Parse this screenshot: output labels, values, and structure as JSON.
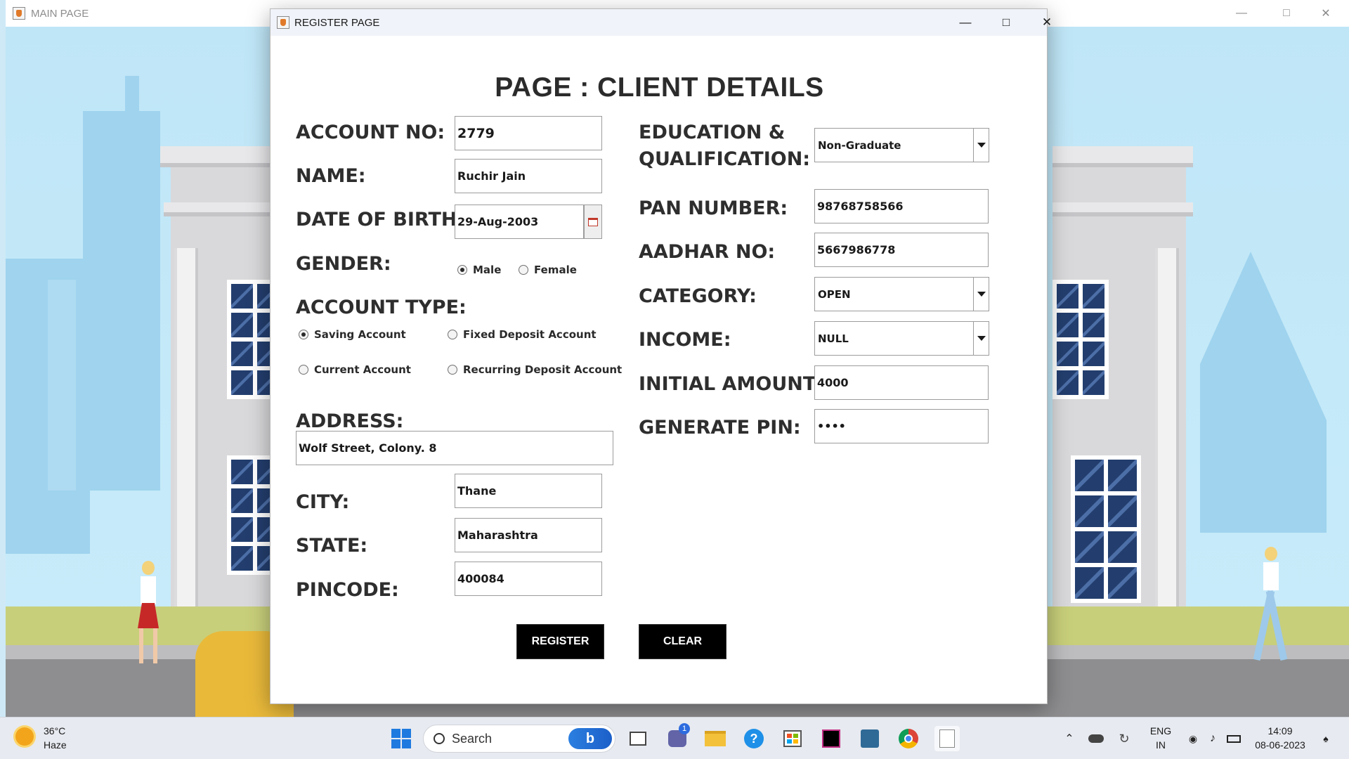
{
  "main_window": {
    "title": "MAIN PAGE"
  },
  "dialog": {
    "title": "REGISTER PAGE",
    "heading": "PAGE : CLIENT DETAILS"
  },
  "form": {
    "account_no": {
      "label": "ACCOUNT NO:",
      "value": "2779"
    },
    "name": {
      "label": "NAME:",
      "value": "Ruchir Jain"
    },
    "dob": {
      "label": "DATE OF BIRTH:",
      "value": "29-Aug-2003"
    },
    "gender": {
      "label": "GENDER:",
      "options": [
        "Male",
        "Female"
      ],
      "selected": "Male"
    },
    "account_type": {
      "label": "ACCOUNT TYPE:",
      "options": [
        "Saving Account",
        "Fixed Deposit Account",
        "Current Account",
        "Recurring Deposit Account"
      ],
      "selected": "Saving Account"
    },
    "address": {
      "label": "ADDRESS:",
      "value": "Wolf Street, Colony. 8"
    },
    "city": {
      "label": "CITY:",
      "value": "Thane"
    },
    "state": {
      "label": "STATE:",
      "value": "Maharashtra"
    },
    "pincode": {
      "label": "PINCODE:",
      "value": "400084"
    },
    "education": {
      "label_line1": "EDUCATION &",
      "label_line2": "QUALIFICATION:",
      "value": "Non-Graduate"
    },
    "pan": {
      "label": "PAN NUMBER:",
      "value": "98768758566"
    },
    "aadhar": {
      "label": "AADHAR NO:",
      "value": "5667986778"
    },
    "category": {
      "label": "CATEGORY:",
      "value": "OPEN"
    },
    "income": {
      "label": "INCOME:",
      "value": "NULL"
    },
    "initial_amount": {
      "label": "INITIAL AMOUNT:",
      "value": "4000"
    },
    "pin": {
      "label": "GENERATE PIN:",
      "value": "••••"
    }
  },
  "buttons": {
    "register": "REGISTER",
    "clear": "CLEAR"
  },
  "taskbar": {
    "weather_temp": "36°C",
    "weather_desc": "Haze",
    "search_label": "Search",
    "teams_badge": "1",
    "lang_line1": "ENG",
    "lang_line2": "IN",
    "time": "14:09",
    "date": "08-06-2023"
  },
  "colors": {
    "sky": "#bfe6f7",
    "building": "#d9d9db",
    "window_glass": "#233e6e",
    "button_bg": "#000000",
    "taskbar_bg": "#e7eaf0"
  }
}
